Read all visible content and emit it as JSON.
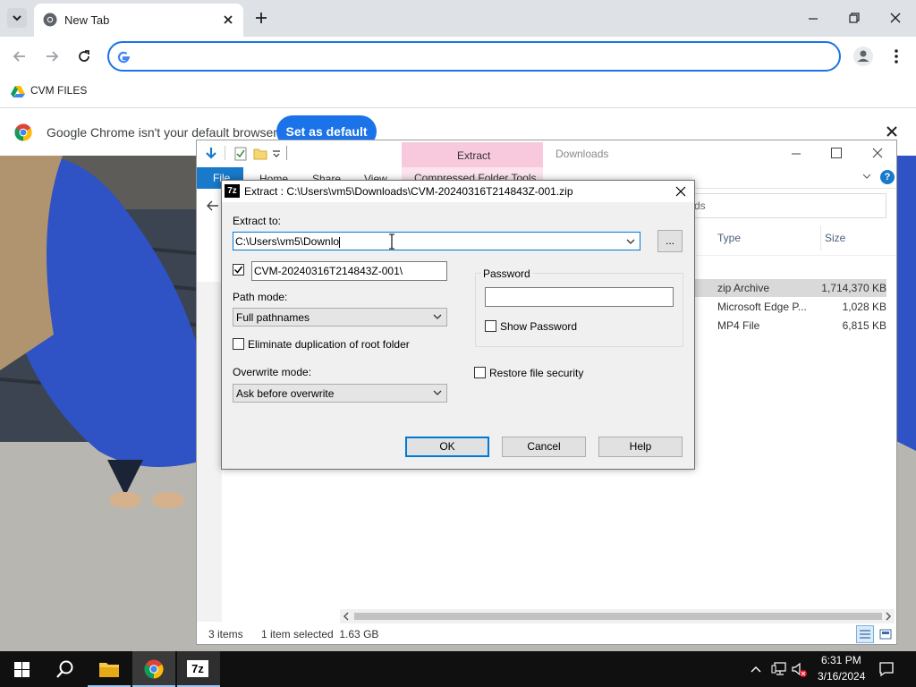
{
  "browser": {
    "tab_title": "New Tab",
    "omnibox_value": "",
    "bookmark": "CVM FILES",
    "infobar_text": "Google Chrome isn't your default browser",
    "infobar_button": "Set as default"
  },
  "explorer": {
    "ribbon_extract": "Extract",
    "window_title": "Downloads",
    "tabs": [
      "File",
      "Home",
      "Share",
      "View"
    ],
    "tool_tab": "Compressed Folder Tools",
    "search_text": "ds",
    "columns": [
      "Type",
      "Size"
    ],
    "rows": [
      {
        "type": "zip Archive",
        "size": "1,714,370 KB"
      },
      {
        "type": "Microsoft Edge P...",
        "size": "1,028 KB"
      },
      {
        "type": "MP4 File",
        "size": "6,815 KB"
      }
    ],
    "status_items": "3 items",
    "status_selected": "1 item selected  1.63 GB",
    "accent_color": "#1979ca"
  },
  "dialog": {
    "icon_text": "7z",
    "title": "Extract : C:\\Users\\vm5\\Downloads\\CVM-20240316T214843Z-001.zip",
    "extract_to_label": "Extract to:",
    "extract_to_value": "C:\\Users\\vm5\\Downlo",
    "browse_label": "...",
    "subfolder_value": "CVM-20240316T214843Z-001\\",
    "path_mode_label": "Path mode:",
    "path_mode_value": "Full pathnames",
    "eliminate_label": "Eliminate duplication of root folder",
    "overwrite_label": "Overwrite mode:",
    "overwrite_value": "Ask before overwrite",
    "password_group": "Password",
    "password_value": "",
    "show_password_label": "Show Password",
    "restore_security_label": "Restore file security",
    "ok": "OK",
    "cancel": "Cancel",
    "help": "Help"
  },
  "taskbar": {
    "time": "6:31 PM",
    "date": "3/16/2024",
    "sevenzip_text": "7z"
  }
}
